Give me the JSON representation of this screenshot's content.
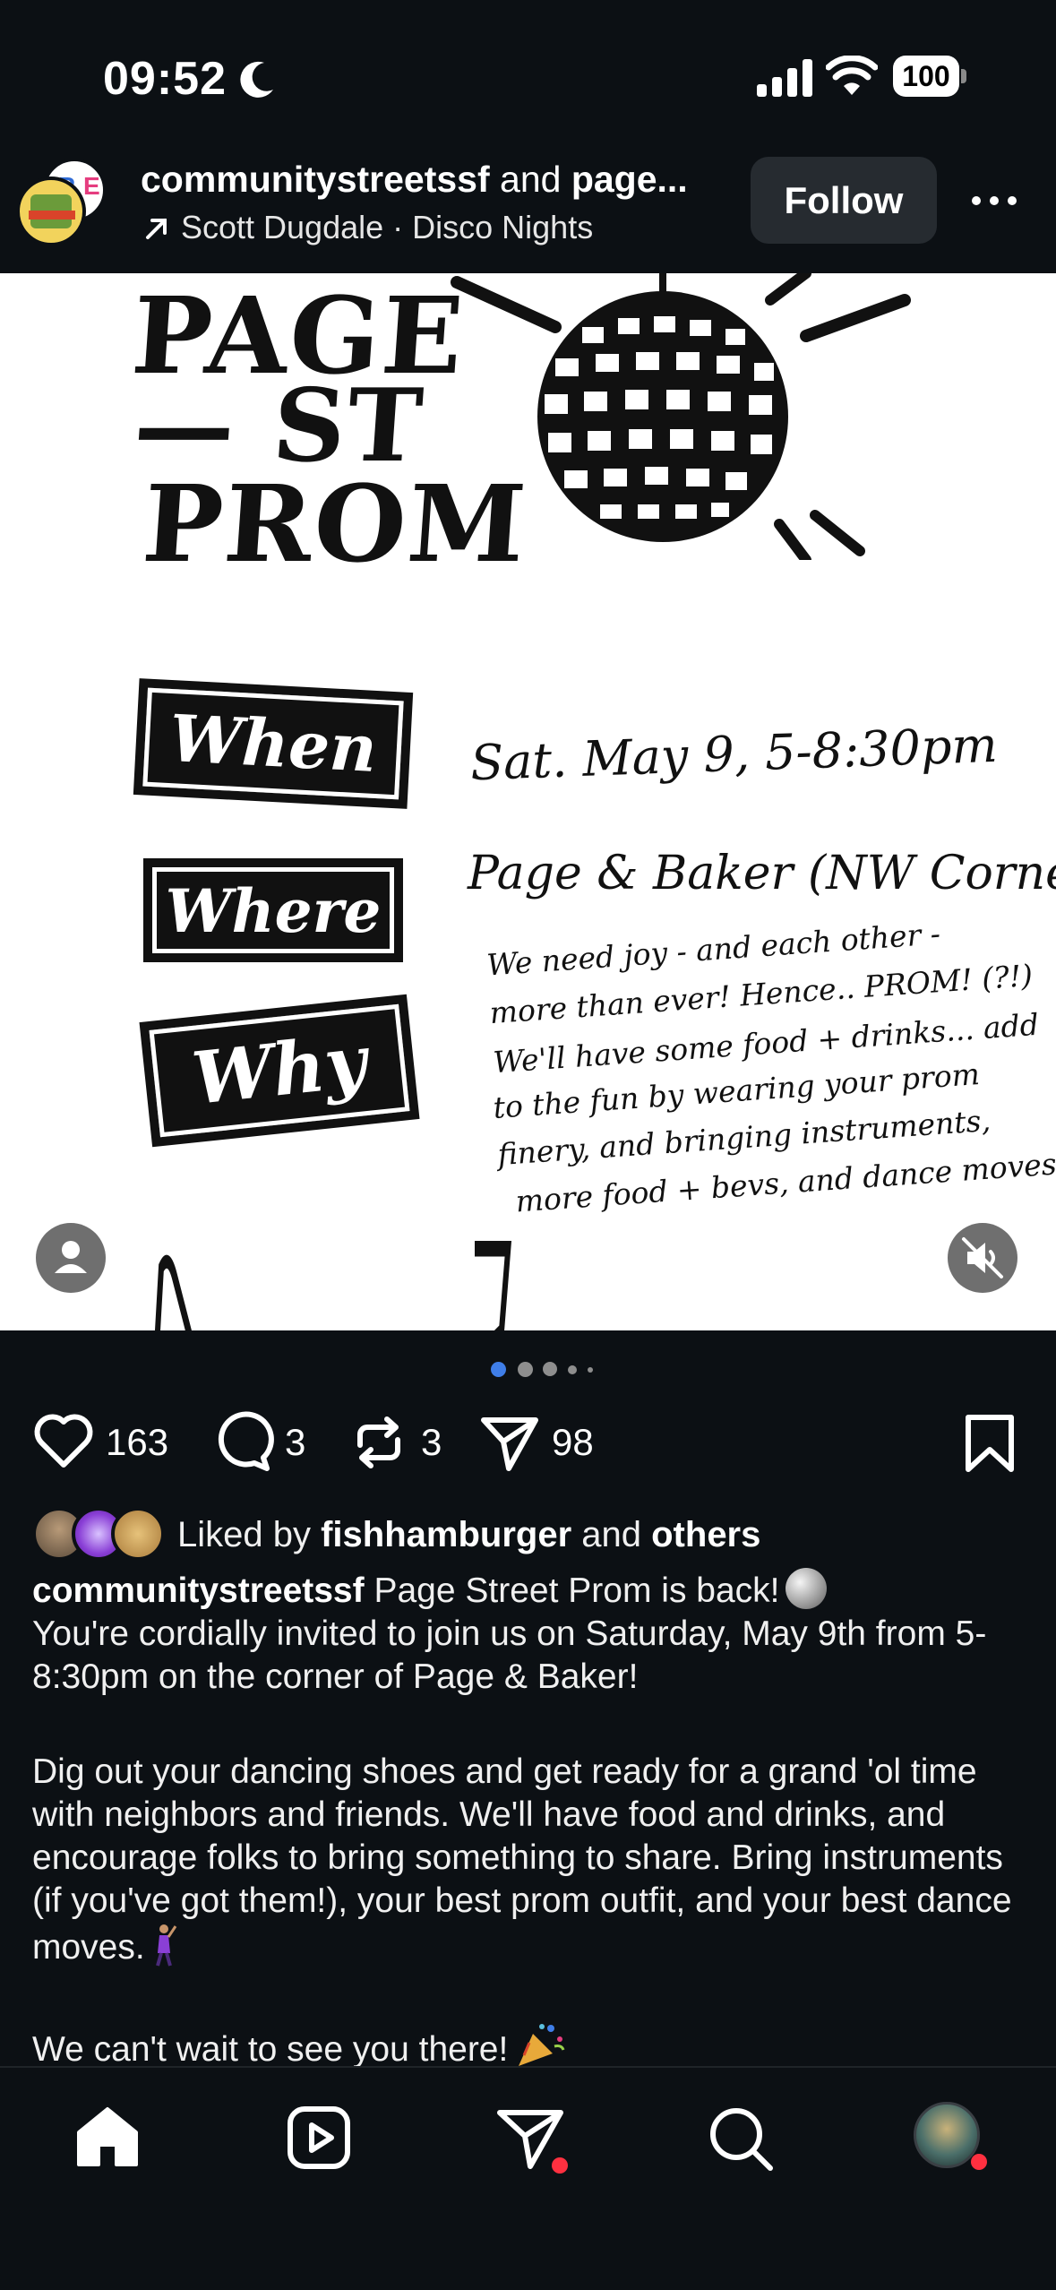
{
  "status_bar": {
    "time": "09:52",
    "battery": "100",
    "icons": [
      "moon-icon",
      "signal-icon",
      "wifi-icon",
      "battery-icon"
    ]
  },
  "post": {
    "header": {
      "username_primary": "communitystreetssf",
      "username_join": " and ",
      "username_secondary": "page...",
      "audio_line": "Scott Dugdale · Disco Nights",
      "follow_label": "Follow"
    },
    "flyer": {
      "title_lines": [
        "PAGE",
        "— ST",
        "PROM"
      ],
      "labels": {
        "when": "When",
        "where": "Where",
        "why": "Why"
      },
      "when_text": "Sat. May 9, 5-8:30pm",
      "where_text": "Page & Baker (NW Corner)",
      "why_lines": [
        "We need joy - and each other -",
        "more than ever! Hence.. PROM! (?!)",
        "We'll have some food + drinks... add",
        "to the fun by wearing your prom",
        "finery, and bringing instruments,",
        "more food + bevs, and dance moves!"
      ]
    },
    "carousel": {
      "total_dots": 5,
      "active_index": 0
    },
    "actions": {
      "likes": "163",
      "comments": "3",
      "reposts": "3",
      "shares": "98"
    },
    "liked_by": {
      "prefix": "Liked by ",
      "user": "fishhamburger",
      "join": " and ",
      "others": "others"
    },
    "caption": {
      "username": "communitystreetssf",
      "p1": " Page Street Prom is back!",
      "p1b": "You're cordially invited to join us on Saturday, May 9th from 5-8:30pm on the corner of Page & Baker!",
      "p2": "Dig out your dancing shoes and get ready for a grand 'ol time with neighbors and friends. We'll have food and drinks, and encourage folks to bring something to share. Bring instruments (if you've got them!), your best prom outfit, and your best dance moves.",
      "p3": "We can't wait to see you there!"
    }
  },
  "bottom_nav": {
    "items": [
      "home-icon",
      "reels-icon",
      "direct-messages-icon",
      "search-icon",
      "profile-avatar"
    ]
  },
  "colors": {
    "background": "#0c1014",
    "button_bg": "#262b30",
    "notification_red": "#ff3040",
    "active_dot": "#3f7ee8"
  }
}
